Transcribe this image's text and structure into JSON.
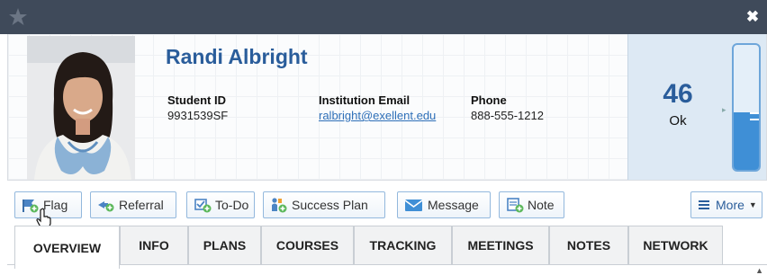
{
  "window": {
    "close_label": "✖"
  },
  "student": {
    "name": "Randi Albright",
    "id_label": "Student ID",
    "id_value": "9931539SF",
    "email_label": "Institution Email",
    "email_value": "ralbright@exellent.edu",
    "phone_label": "Phone",
    "phone_value": "888-555-1212"
  },
  "score": {
    "value": "46",
    "status": "Ok",
    "gauge_fill_fraction": 0.46,
    "accent_color": "#2a5d9b"
  },
  "toolbar": {
    "flag": "Flag",
    "referral": "Referral",
    "todo": "To-Do",
    "success_plan": "Success Plan",
    "message": "Message",
    "note": "Note",
    "more": "More"
  },
  "tabs": [
    "OVERVIEW",
    "INFO",
    "PLANS",
    "COURSES",
    "TRACKING",
    "MEETINGS",
    "NOTES",
    "NETWORK"
  ],
  "active_tab": "OVERVIEW"
}
